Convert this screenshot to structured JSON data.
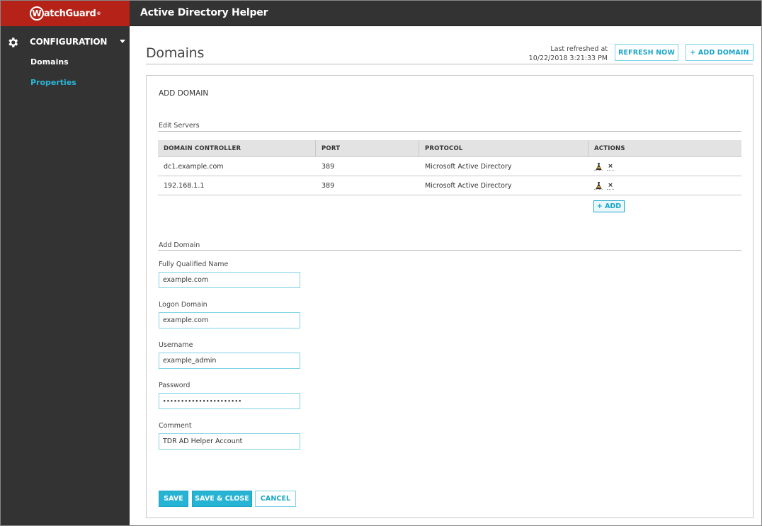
{
  "brand": {
    "logo_letter": "W",
    "logo_text": "atchGuard",
    "logo_reg": "®",
    "brand_color": "#b52217",
    "accent_color": "#27b3d3"
  },
  "header": {
    "app_title": "Active Directory Helper"
  },
  "sidebar": {
    "section": {
      "icon": "gear-icon",
      "label": "CONFIGURATION",
      "expanded": true
    },
    "items": [
      {
        "label": "Domains",
        "active": false
      },
      {
        "label": "Properties",
        "active": true
      }
    ]
  },
  "page": {
    "title": "Domains",
    "refresh": {
      "label_line1": "Last refreshed at",
      "label_line2": "10/22/2018 3:21:33 PM"
    },
    "buttons": {
      "refresh_now": "REFRESH NOW",
      "add_domain": "+ ADD DOMAIN"
    }
  },
  "panel": {
    "title": "ADD DOMAIN",
    "edit_servers": {
      "label": "Edit Servers",
      "columns": [
        "DOMAIN CONTROLLER",
        "PORT",
        "PROTOCOL",
        "ACTIONS"
      ],
      "rows": [
        {
          "domain_controller": "dc1.example.com",
          "port": "389",
          "protocol": "Microsoft Active Directory",
          "actions": [
            "test-icon",
            "delete-icon"
          ]
        },
        {
          "domain_controller": "192.168.1.1",
          "port": "389",
          "protocol": "Microsoft Active Directory",
          "actions": [
            "test-icon",
            "delete-icon"
          ]
        }
      ],
      "add_button": "+ ADD",
      "delete_glyph": "×"
    },
    "add_domain": {
      "label": "Add Domain",
      "fields": {
        "fqdn": {
          "label": "Fully Qualified Name",
          "value": "example.com"
        },
        "logon_domain": {
          "label": "Logon Domain",
          "value": "example.com"
        },
        "username": {
          "label": "Username",
          "value": "example_admin"
        },
        "password": {
          "label": "Password",
          "value": "••••••••••••••••••••••"
        },
        "comment": {
          "label": "Comment",
          "value": "TDR AD Helper Account"
        }
      }
    },
    "actions": {
      "save": "SAVE",
      "save_close": "SAVE & CLOSE",
      "cancel": "CANCEL"
    }
  }
}
